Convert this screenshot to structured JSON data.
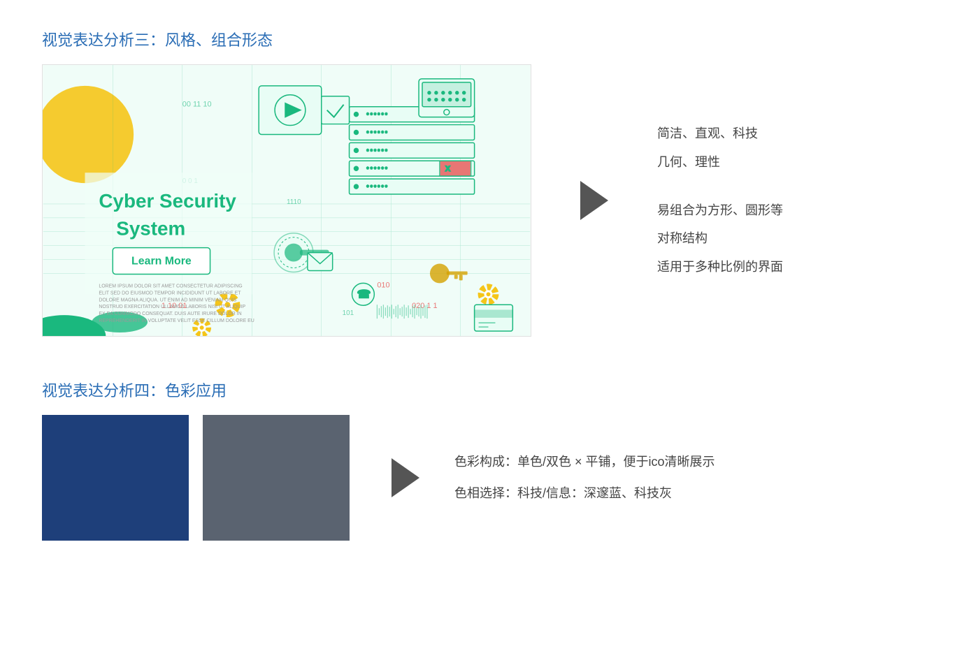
{
  "section3": {
    "title": "视觉表达分析三：风格、组合形态",
    "cyber_title_line1": "Cyber Security",
    "cyber_title_line2": "System",
    "learn_more_btn": "Learn More",
    "description": [
      "简洁、直观、科技",
      "几何、理性",
      "",
      "易组合为方形、圆形等",
      "对称结构",
      "适用于多种比例的界面"
    ]
  },
  "section4": {
    "title": "视觉表达分析四：色彩应用",
    "color_blue": "#1e3f7a",
    "color_gray": "#5a6370",
    "description": [
      "色彩构成：单色/双色 × 平铺，便于ico清晰展示",
      "色相选择：科技/信息：深邃蓝、科技灰"
    ]
  }
}
